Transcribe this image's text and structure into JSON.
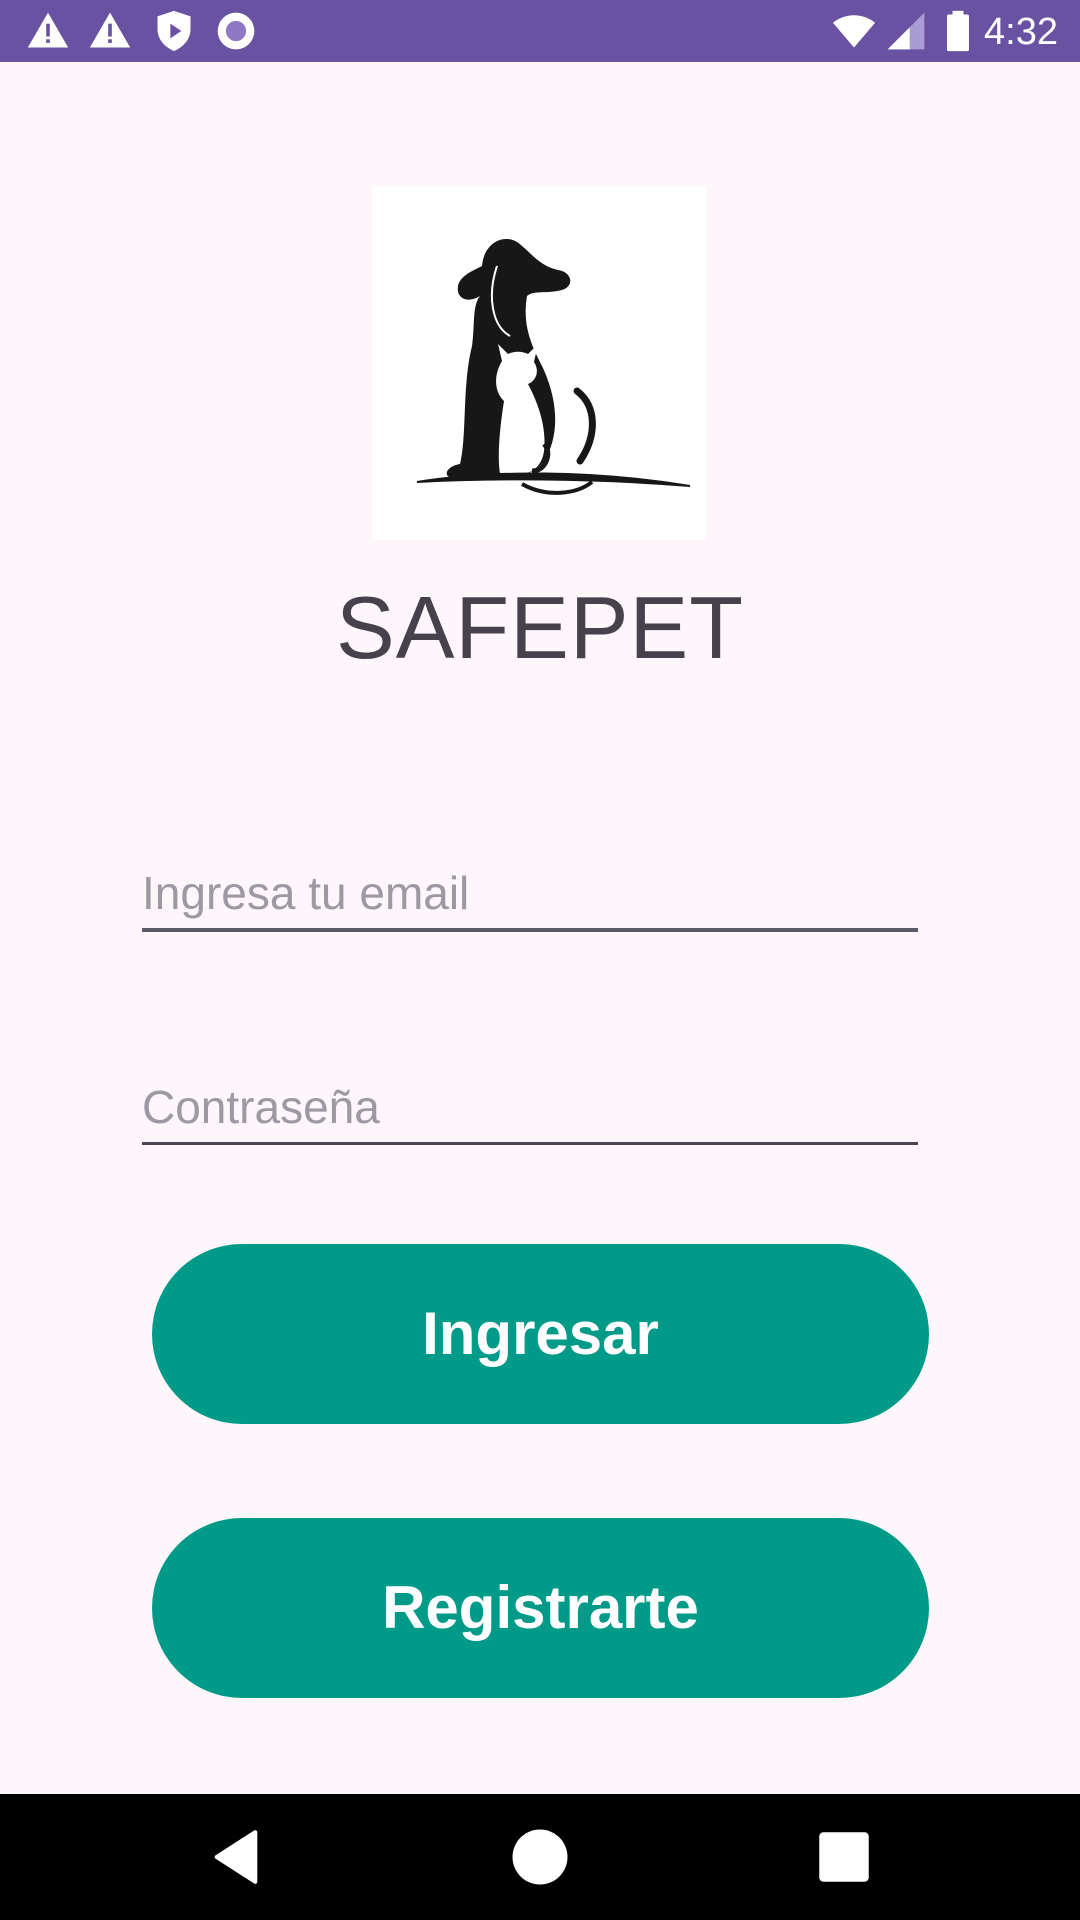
{
  "status_bar": {
    "time": "4:32",
    "left_icons": [
      "warning-icon",
      "warning-icon",
      "shield-icon",
      "record-icon"
    ],
    "right_icons": [
      "wifi-icon",
      "cell-signal-icon",
      "battery-icon"
    ],
    "background_color": "#6a52a3"
  },
  "logo": {
    "icon": "dog-and-cat-logo"
  },
  "app": {
    "title": "SAFEPET"
  },
  "form": {
    "email_placeholder": "Ingresa tu email",
    "email_value": "",
    "password_placeholder": "Contraseña",
    "password_value": ""
  },
  "buttons": {
    "login_label": "Ingresar",
    "register_label": "Registrarte",
    "color": "#009a88"
  },
  "nav_bar": {
    "icons": [
      "back-icon",
      "home-icon",
      "recents-icon"
    ]
  }
}
